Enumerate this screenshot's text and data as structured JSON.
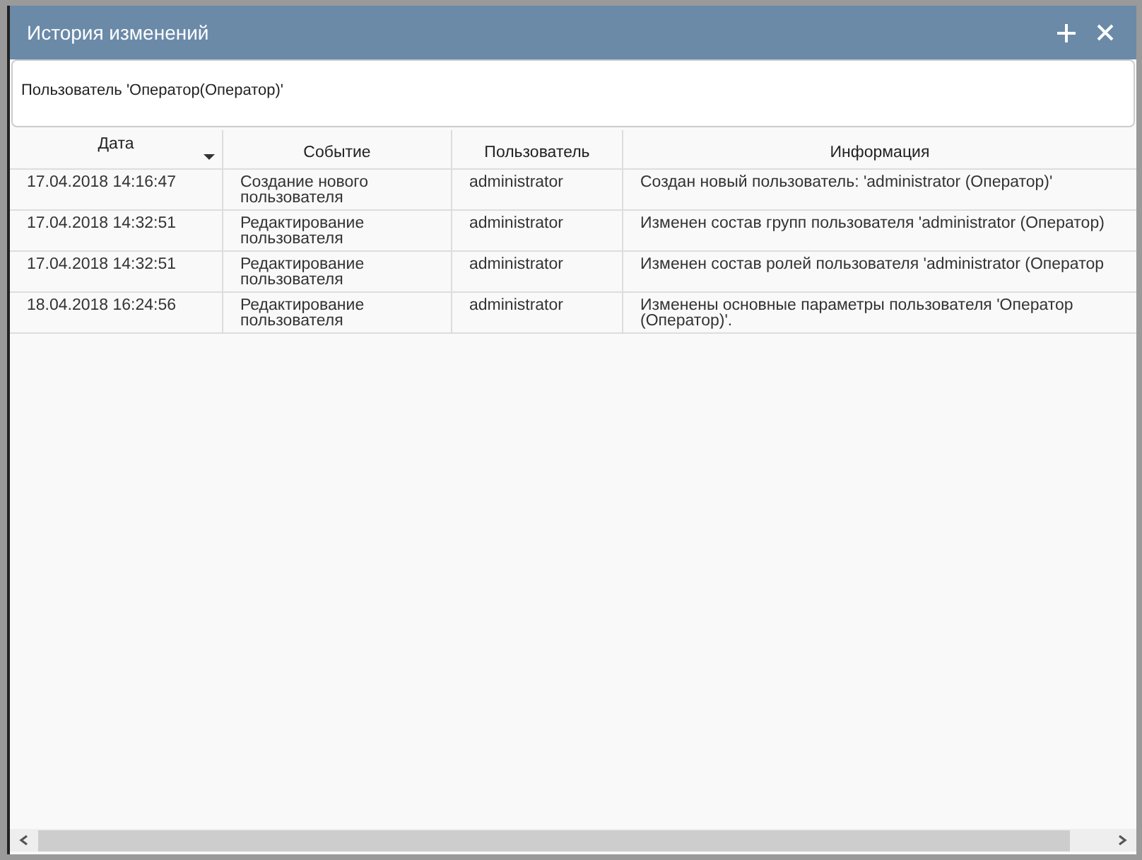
{
  "window": {
    "title": "История изменений"
  },
  "header_text": "Пользователь 'Оператор(Оператор)'",
  "table": {
    "columns": [
      {
        "label": "Дата",
        "sorted": true
      },
      {
        "label": "Событие",
        "sorted": false
      },
      {
        "label": "Пользователь",
        "sorted": false
      },
      {
        "label": "Информация",
        "sorted": false
      }
    ],
    "rows": [
      [
        "17.04.2018 14:16:47",
        "Создание нового пользователя",
        "administrator",
        "Создан новый пользователь: 'administrator (Оператор)'"
      ],
      [
        "17.04.2018 14:32:51",
        "Редактирование пользователя",
        "administrator",
        "Изменен состав групп пользователя 'administrator (Оператор)"
      ],
      [
        "17.04.2018 14:32:51",
        "Редактирование пользователя",
        "administrator",
        "Изменен состав ролей пользователя 'administrator (Оператор"
      ],
      [
        "18.04.2018 16:24:56",
        "Редактирование пользователя",
        "administrator",
        "Изменены основные параметры пользователя 'Оператор (Оператор)'."
      ]
    ]
  }
}
